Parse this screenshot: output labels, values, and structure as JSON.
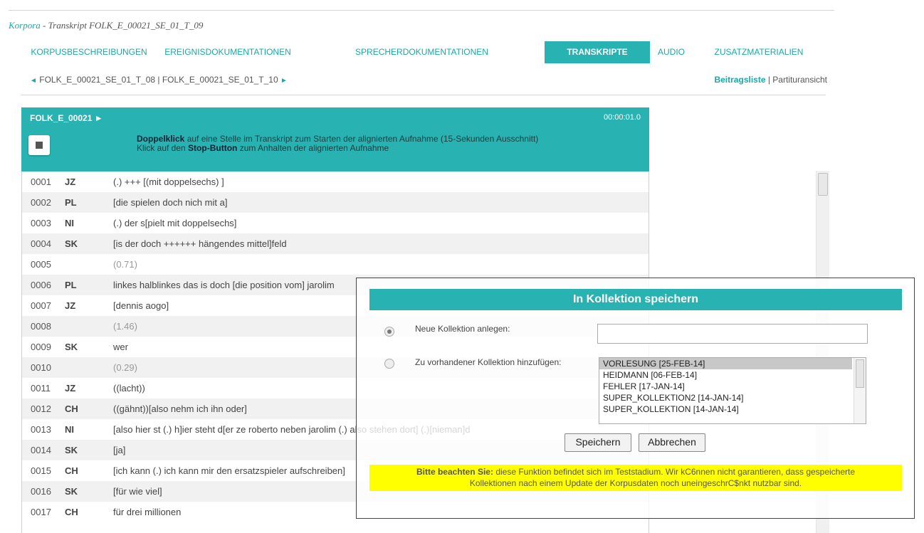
{
  "breadcrumb": {
    "link": "Korpora",
    "separator": " - ",
    "rest": "Transkript FOLK_E_00021_SE_01_T_09"
  },
  "nav": {
    "tabs": [
      {
        "label": "KORPUSBESCHREIBUNGEN"
      },
      {
        "label": "EREIGNISDOKUMENTATIONEN"
      },
      {
        "label": "SPRECHERDOKUMENTATIONEN"
      },
      {
        "label": "TRANSKRIPTE",
        "active": true
      },
      {
        "label": "AUDIO"
      },
      {
        "label": "ZUSATZMATERIALIEN"
      }
    ]
  },
  "pager": {
    "prev": "FOLK_E_00021_SE_01_T_08",
    "sep": " | ",
    "next": "FOLK_E_00021_SE_01_T_10"
  },
  "viewswitch": {
    "active": "Beitragsliste",
    "sep": " | ",
    "other": "Partituransicht"
  },
  "player": {
    "corpus": "FOLK_E_00021 ►",
    "time": "00:00:01.0",
    "hint1_bold": "Doppelklick",
    "hint1_rest": " auf eine Stelle im Transkript zum Starten der alignierten Aufnahme (15-Sekunden Ausschnitt)",
    "hint2_pre": "Klick auf den ",
    "hint2_bold": "Stop-Button",
    "hint2_rest": " zum Anhalten der alignierten Aufnahme"
  },
  "transcript": [
    {
      "num": "0001",
      "spk": "JZ",
      "text": "(.) +++ [(mit doppelsechs) ]"
    },
    {
      "num": "0002",
      "spk": "PL",
      "text": "[die spielen doch nich mit a]"
    },
    {
      "num": "0003",
      "spk": "NI",
      "text": "(.) der s[pielt mit doppelsechs]"
    },
    {
      "num": "0004",
      "spk": "SK",
      "text": "[is der doch ++++++ hängendes mittel]feld"
    },
    {
      "num": "0005",
      "spk": "",
      "text": "(0.71)",
      "pause": true
    },
    {
      "num": "0006",
      "spk": "PL",
      "text": "linkes halblinkes das is doch [die position vom] jarolim"
    },
    {
      "num": "0007",
      "spk": "JZ",
      "text": "[dennis aogo]"
    },
    {
      "num": "0008",
      "spk": "",
      "text": "(1.46)",
      "pause": true
    },
    {
      "num": "0009",
      "spk": "SK",
      "text": "wer"
    },
    {
      "num": "0010",
      "spk": "",
      "text": "(0.29)",
      "pause": true
    },
    {
      "num": "0011",
      "spk": "JZ",
      "text": "((lacht))"
    },
    {
      "num": "0012",
      "spk": "CH",
      "text": "((gähnt))[also nehm ich ihn oder]"
    },
    {
      "num": "0013",
      "spk": "NI",
      "text": "[also hier st (.) h]ier steht d[er ze roberto neben jarolim (.) also stehen dort] (.)[nieman]d"
    },
    {
      "num": "0014",
      "spk": "SK",
      "text": "[ja]"
    },
    {
      "num": "0015",
      "spk": "CH",
      "text": "[ich kann (.) ich kann mir den ersatzspieler aufschreiben]"
    },
    {
      "num": "0016",
      "spk": "SK",
      "text": "[für wie viel]"
    },
    {
      "num": "0017",
      "spk": "CH",
      "text": "für drei millionen"
    }
  ],
  "dialog": {
    "title": "In Kollektion speichern",
    "option_new": "Neue Kollektion anlegen:",
    "option_existing": "Zu vorhandener Kollektion hinzufügen:",
    "new_value": "",
    "collections": [
      "VORLESUNG [25-FEB-14]",
      "HEIDMANN [06-FEB-14]",
      "FEHLER [17-JAN-14]",
      "SUPER_KOLLEKTION2 [14-JAN-14]",
      "SUPER_KOLLEKTION [14-JAN-14]"
    ],
    "save": "Speichern",
    "cancel": "Abbrechen",
    "warn_bold": "Bitte beachten Sie:",
    "warn_line1": " diese Funktion befindet sich im Teststadium. Wir kC6nnen nicht garantieren, dass gespeicherte",
    "warn_line2": "Kollektionen nach einem Update der Korpusdaten noch uneingeschrC$nkt nutzbar sind."
  }
}
